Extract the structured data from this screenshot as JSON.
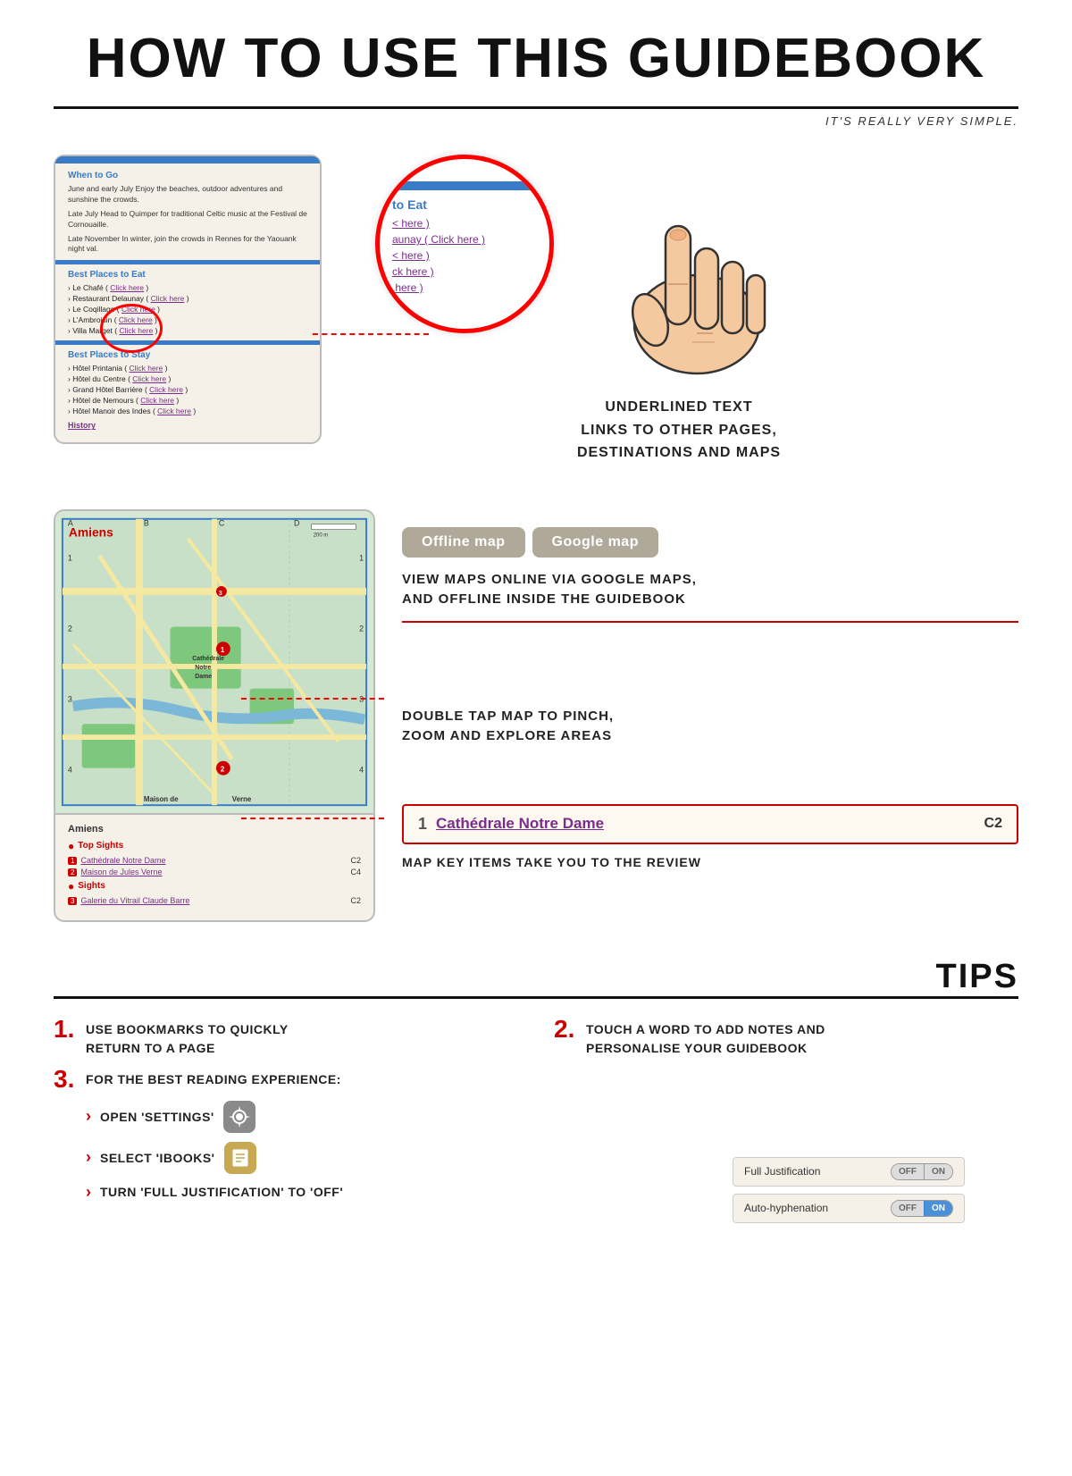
{
  "header": {
    "title": "HOW TO USE THIS GUIDEBOOK",
    "subtitle": "IT'S REALLY VERY SIMPLE."
  },
  "section1": {
    "mockup": {
      "when_to_go_title": "When to Go",
      "when_to_go_text1": "June and early July Enjoy the beaches, outdoor adventures and sunshine the crowds.",
      "when_to_go_text2": "Late July Head to Quimper for traditional Celtic music at the Festival de Cornouaille.",
      "when_to_go_text3": "Late November In winter, join the crowds in Rennes for the Yaouank night val.",
      "best_eat_title": "Best Places to Eat",
      "eat_items": [
        {
          "name": "Le Chafé",
          "link": "Click here"
        },
        {
          "name": "Restaurant Delaunay",
          "link": "Click here"
        },
        {
          "name": "Le Coqillage",
          "link": "Click here"
        },
        {
          "name": "L'Ambroisin",
          "link": "Click here"
        },
        {
          "name": "Villa Marget",
          "link": "Click here"
        }
      ],
      "best_stay_title": "Best Places to Stay",
      "stay_items": [
        {
          "name": "Hôtel Printania",
          "link": "Click here"
        },
        {
          "name": "Hôtel du Centre",
          "link": "Click here"
        },
        {
          "name": "Grand Hôtel Barrière",
          "link": "Click here"
        },
        {
          "name": "Hôtel de Nemours",
          "link": "Click here"
        },
        {
          "name": "Hôtel Manoir des Indes",
          "link": "Click here"
        }
      ],
      "history_link": "History"
    },
    "zoom": {
      "section_label": "to Eat",
      "links": [
        "< here )",
        "aunay ( Click here )",
        "< here )",
        "ck here )",
        ".here )"
      ]
    },
    "caption": "UNDERLINED TEXT\nLINKS TO OTHER PAGES,\nDESTINATIONS AND MAPS"
  },
  "section2": {
    "buttons": {
      "offline": "Offline map",
      "google": "Google map"
    },
    "desc1": "VIEW MAPS ONLINE VIA GOOGLE MAPS,\nAND OFFLINE INSIDE THE GUIDEBOOK",
    "desc2": "DOUBLE TAP MAP TO PINCH,\nZOOM AND EXPLORE AREAS",
    "map_key": {
      "number": "1",
      "link_text": "Cathédrale Notre Dame",
      "coord": "C2"
    },
    "map_key_desc": "MAP KEY ITEMS TAKE YOU TO THE REVIEW",
    "mockup": {
      "city": "Amiens",
      "top_sights_label": "Top Sights",
      "items": [
        {
          "num": "1",
          "name": "Cathédrale Notre Dame",
          "coord": "C2"
        },
        {
          "num": "2",
          "name": "Maison de Jules Verne",
          "coord": "C4"
        }
      ],
      "sights_label": "Sights",
      "sights_items": [
        {
          "num": "3",
          "name": "Galerie du Vitrail Claude Barre",
          "coord": "C2"
        }
      ]
    }
  },
  "tips": {
    "title": "TIPS",
    "tip1": {
      "number": "1.",
      "text": "USE BOOKMARKS TO QUICKLY\nRETURN TO A PAGE"
    },
    "tip2": {
      "number": "2.",
      "text": "TOUCH A WORD TO ADD NOTES AND\nPERSONALISE YOUR GUIDEBOOK"
    },
    "tip3": {
      "number": "3.",
      "text": "FOR THE BEST READING EXPERIENCE:",
      "subitems": [
        {
          "text": "Open 'Settings'",
          "icon": "⚙️"
        },
        {
          "text": "Select 'iBooks'",
          "icon": "📖"
        },
        {
          "text": "Turn 'Full Justification' to 'off'",
          "icon": ""
        }
      ]
    },
    "toggles": [
      {
        "label": "Full Justification",
        "state": "OFF"
      },
      {
        "label": "Auto-hyphenation",
        "state": "ON"
      }
    ]
  }
}
